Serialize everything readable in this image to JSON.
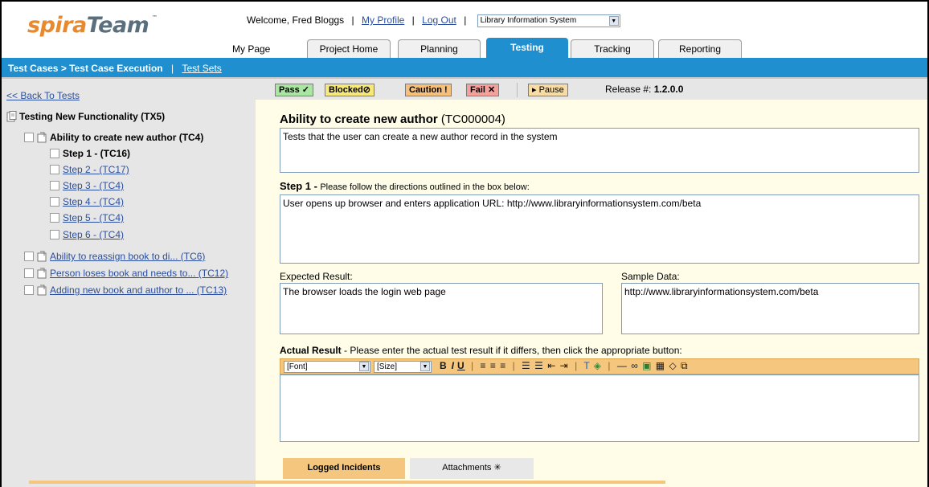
{
  "header": {
    "logo_spira": "spira",
    "logo_team": "Team",
    "logo_tm": "™",
    "welcome": "Welcome, Fred Bloggs",
    "my_profile": "My Profile",
    "log_out": "Log Out",
    "project_select": "Library Information System",
    "my_page_label": "My Page"
  },
  "tabs": [
    {
      "label": "Project Home"
    },
    {
      "label": "Planning"
    },
    {
      "label": "Testing"
    },
    {
      "label": "Tracking"
    },
    {
      "label": "Reporting"
    }
  ],
  "active_tab": "Testing",
  "breadcrumb": {
    "current": "Test Cases > Test Case Execution",
    "separator": "|",
    "link": "Test Sets"
  },
  "sidebar": {
    "back_link": "<< Back To Tests",
    "test_set": "Testing New Functionality (TX5)",
    "items": [
      {
        "label": "Ability to create new author (TC4)",
        "bold": true
      },
      {
        "label": "Step 1 - (TC16)",
        "bold": true
      },
      {
        "label": "Step 2 - (TC17)"
      },
      {
        "label": "Step 3 - (TC4)"
      },
      {
        "label": "Step 4 - (TC4)"
      },
      {
        "label": "Step 5 - (TC4)"
      },
      {
        "label": "Step 6 - (TC4)"
      },
      {
        "label": "Ability to reassign book to di... (TC6)"
      },
      {
        "label": "Person loses book and needs to... (TC12)"
      },
      {
        "label": "Adding new book and author to ... (TC13)"
      }
    ]
  },
  "toolbar": {
    "pass": "Pass ✓",
    "blocked": "Blocked⊘",
    "caution": "Caution !",
    "fail": "Fail ✕",
    "pause": "▸ Pause",
    "release_label": "Release #:",
    "release_value": "1.2.0.0"
  },
  "main": {
    "title": "Ability to create new author",
    "title_id": "(TC000004)",
    "description": "Tests that the user can create a new author record in the system",
    "step_label": "Step 1 -",
    "step_instructions": "Please follow the directions outlined in the box below:",
    "step_text": "User opens up browser and enters application URL: http://www.libraryinformationsystem.com/beta",
    "expected_label": "Expected Result:",
    "expected_text": "The browser loads the login web page",
    "sample_label": "Sample Data:",
    "sample_text": "http://www.libraryinformationsystem.com/beta",
    "actual_label": "Actual Result",
    "actual_instructions": "- Please enter the actual test result if it differs, then click the appropriate button:",
    "font_select": "[Font]",
    "size_select": "[Size]"
  },
  "bottom_tabs": {
    "incidents": "Logged Incidents",
    "attachments": "Attachments ✳"
  },
  "colors": {
    "accent_blue": "#1f8fd0",
    "editor_orange": "#f5c77e",
    "content_bg": "#fffde8",
    "sidebar_bg": "#e6e6e6"
  }
}
